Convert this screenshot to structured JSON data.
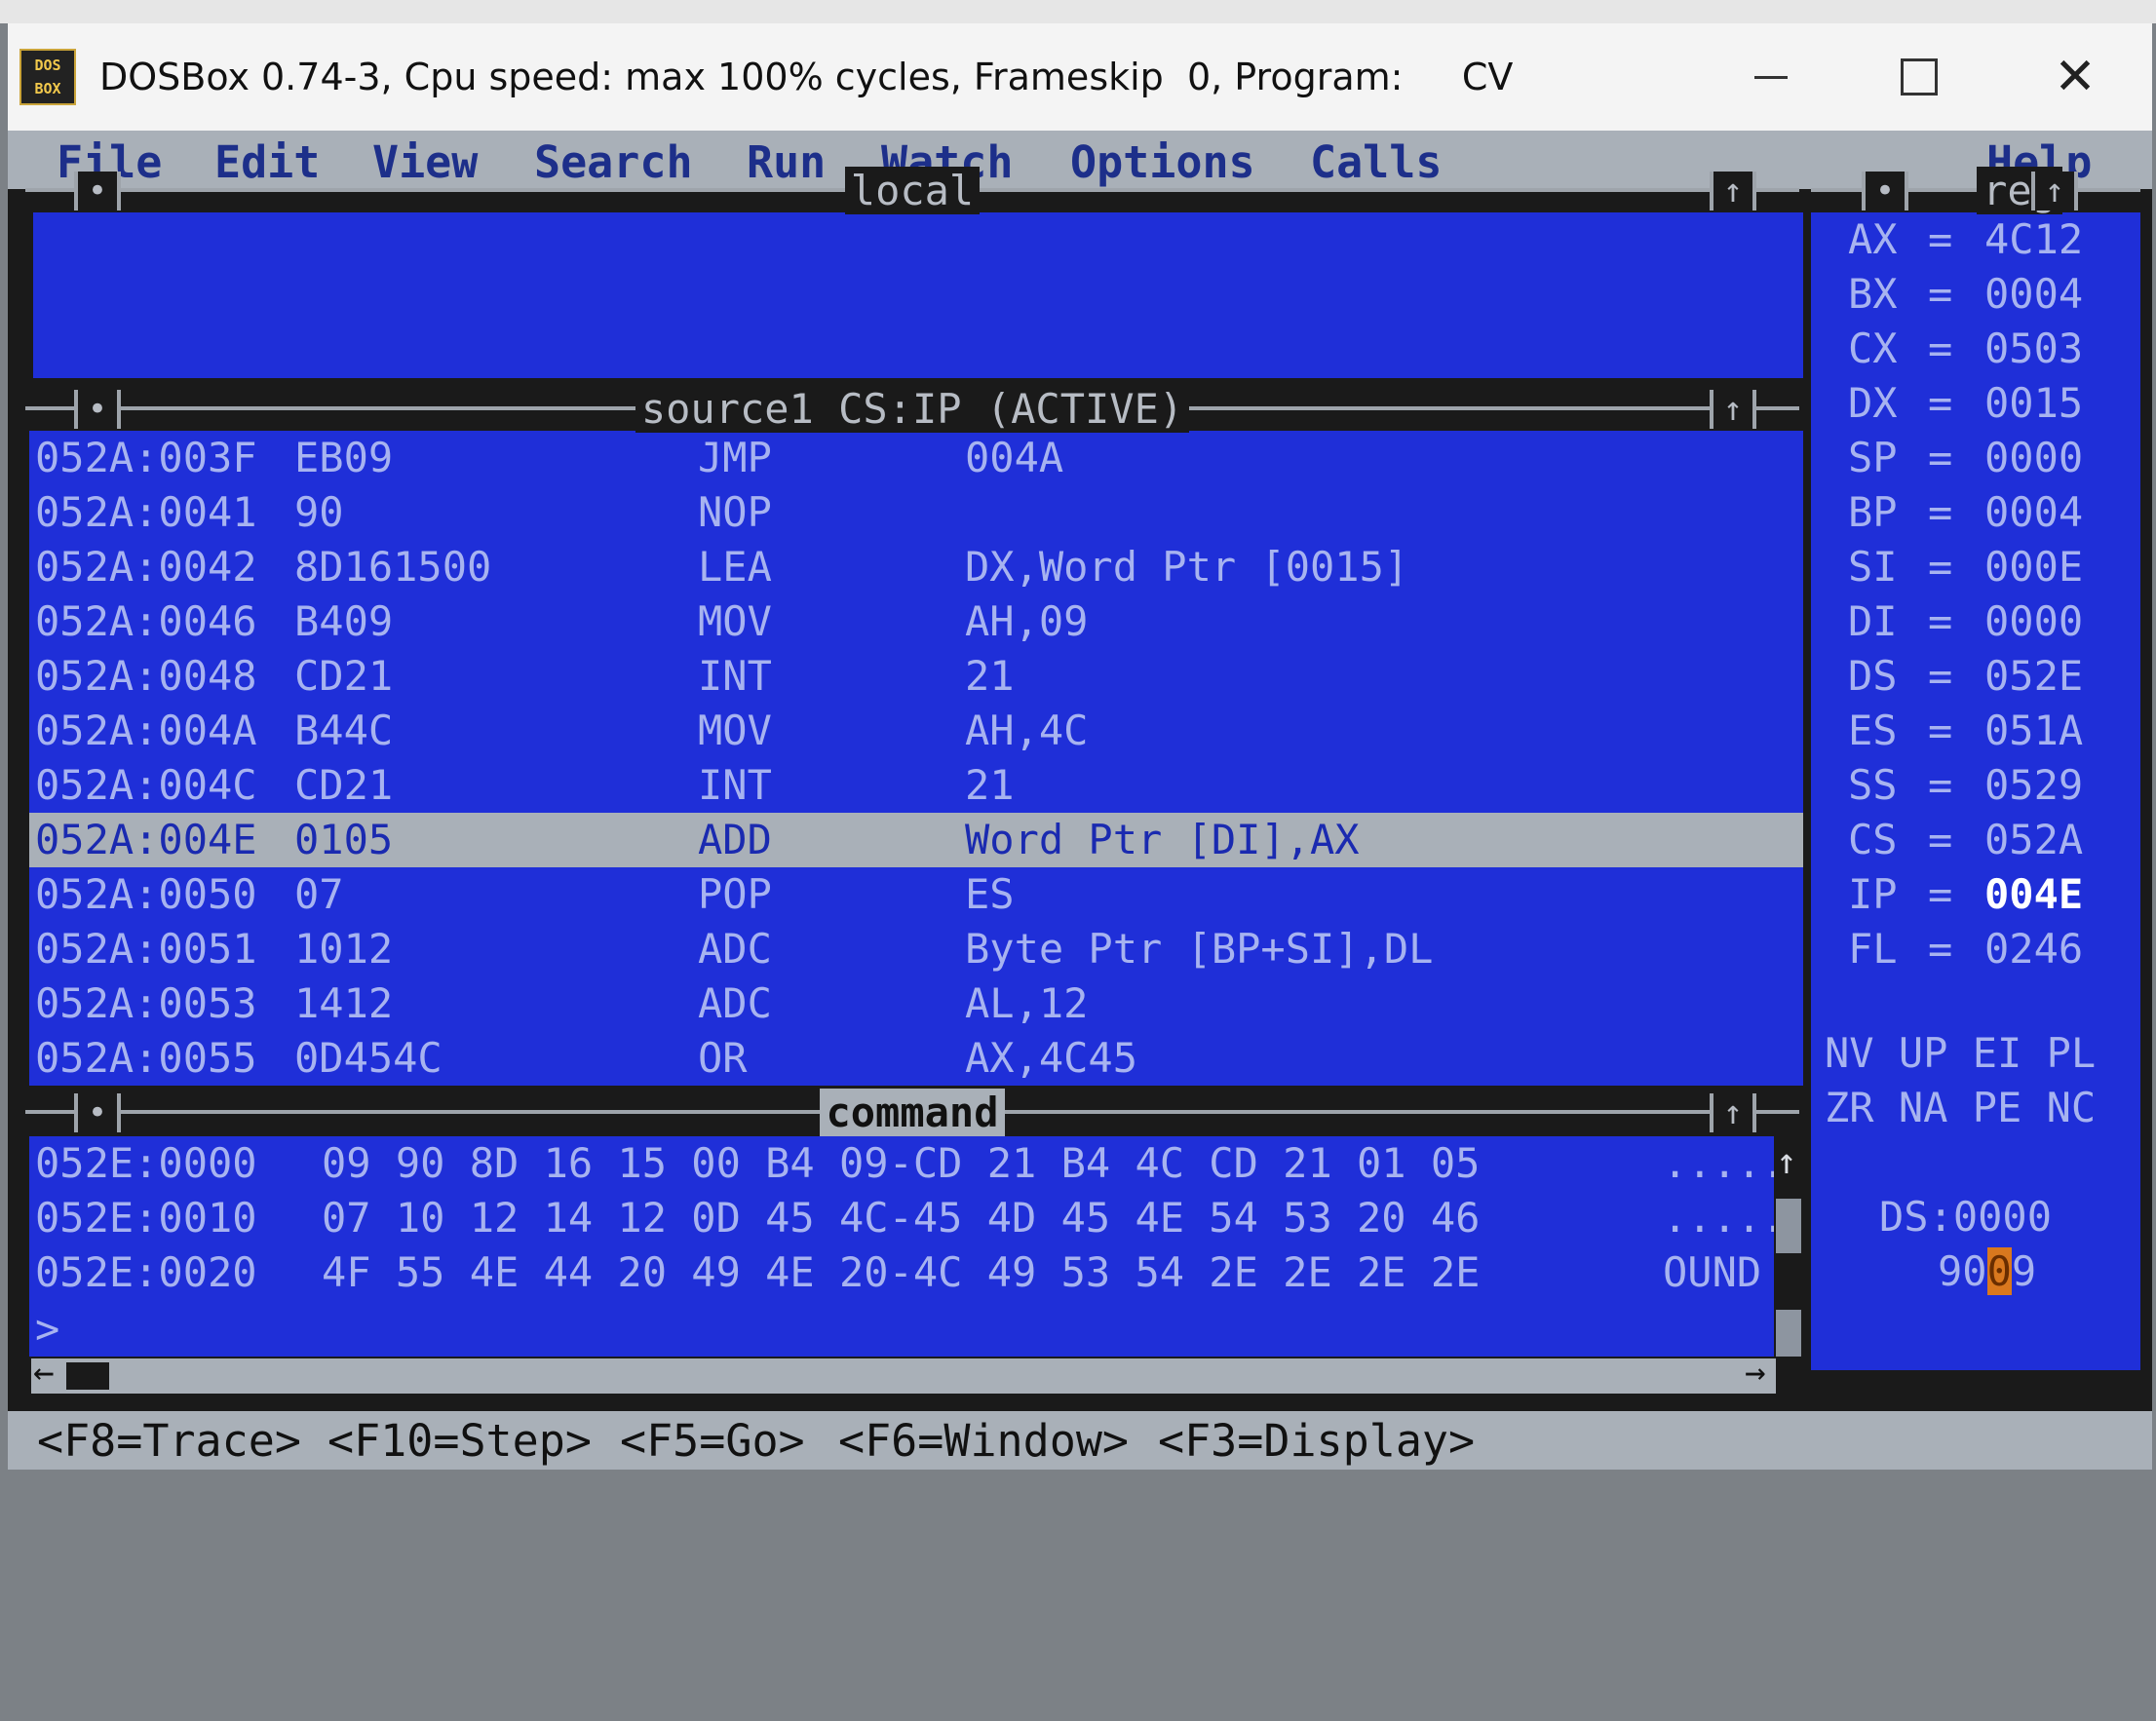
{
  "window": {
    "icon_text": [
      "DOS",
      "BOX"
    ],
    "title": "DOSBox 0.74-3, Cpu speed: max 100% cycles, Frameskip  0, Program:     CV",
    "controls": {
      "minimize": "—",
      "maximize": "☐",
      "close": "✕"
    }
  },
  "menu": {
    "items": [
      "File",
      "Edit",
      "View",
      "Search",
      "Run",
      "Watch",
      "Options",
      "Calls"
    ],
    "help": "Help"
  },
  "panes": {
    "local_title": "local",
    "source_title": "source1 CS:IP (ACTIVE)",
    "command_title": "command",
    "reg_title": "reg",
    "frame_button": "•",
    "max_button": "↑"
  },
  "source_lines": [
    {
      "addr": "052A:003F",
      "code": "EB09",
      "mnemonic": "JMP",
      "operands": "004A"
    },
    {
      "addr": "052A:0041",
      "code": "90",
      "mnemonic": "NOP",
      "operands": ""
    },
    {
      "addr": "052A:0042",
      "code": "8D161500",
      "mnemonic": "LEA",
      "operands": "DX,Word Ptr [0015]"
    },
    {
      "addr": "052A:0046",
      "code": "B409",
      "mnemonic": "MOV",
      "operands": "AH,09"
    },
    {
      "addr": "052A:0048",
      "code": "CD21",
      "mnemonic": "INT",
      "operands": "21"
    },
    {
      "addr": "052A:004A",
      "code": "B44C",
      "mnemonic": "MOV",
      "operands": "AH,4C"
    },
    {
      "addr": "052A:004C",
      "code": "CD21",
      "mnemonic": "INT",
      "operands": "21"
    },
    {
      "addr": "052A:004E",
      "code": "0105",
      "mnemonic": "ADD",
      "operands": "Word Ptr [DI],AX"
    },
    {
      "addr": "052A:0050",
      "code": "07",
      "mnemonic": "POP",
      "operands": "ES"
    },
    {
      "addr": "052A:0051",
      "code": "1012",
      "mnemonic": "ADC",
      "operands": "Byte Ptr [BP+SI],DL"
    },
    {
      "addr": "052A:0053",
      "code": "1412",
      "mnemonic": "ADC",
      "operands": "AL,12"
    },
    {
      "addr": "052A:0055",
      "code": "0D454C",
      "mnemonic": "OR",
      "operands": "AX,4C45"
    }
  ],
  "registers": [
    {
      "name": "AX",
      "eq": "=",
      "value": "4C12"
    },
    {
      "name": "BX",
      "eq": "=",
      "value": "0004"
    },
    {
      "name": "CX",
      "eq": "=",
      "value": "0503"
    },
    {
      "name": "DX",
      "eq": "=",
      "value": "0015"
    },
    {
      "name": "SP",
      "eq": "=",
      "value": "0000"
    },
    {
      "name": "BP",
      "eq": "=",
      "value": "0004"
    },
    {
      "name": "SI",
      "eq": "=",
      "value": "000E"
    },
    {
      "name": "DI",
      "eq": "=",
      "value": "0000"
    },
    {
      "name": "DS",
      "eq": "=",
      "value": "052E"
    },
    {
      "name": "ES",
      "eq": "=",
      "value": "051A"
    },
    {
      "name": "SS",
      "eq": "=",
      "value": "0529"
    },
    {
      "name": "CS",
      "eq": "=",
      "value": "052A"
    },
    {
      "name": "IP",
      "eq": "=",
      "value": "004E"
    },
    {
      "name": "FL",
      "eq": "=",
      "value": "0246"
    }
  ],
  "flags": {
    "row1": "NV UP EI PL",
    "row2": "ZR NA PE NC"
  },
  "ds_watch": {
    "label": "DS:0000",
    "value_pre": "90",
    "value_cursor": "0",
    "value_post": "9"
  },
  "command_lines": [
    {
      "addr": "052E:0000",
      "bytes": "09 90 8D 16 15 00 B4 09-CD 21 B4 4C CD 21 01 05",
      "ascii": "....."
    },
    {
      "addr": "052E:0010",
      "bytes": "07 10 12 14 12 0D 45 4C-45 4D 45 4E 54 53 20 46",
      "ascii": "....."
    },
    {
      "addr": "052E:0020",
      "bytes": "4F 55 4E 44 20 49 4E 20-4C 49 53 54 2E 2E 2E 2E",
      "ascii": "OUND"
    }
  ],
  "prompt": ">",
  "status": [
    "<F8=Trace>",
    "<F10=Step>",
    "<F5=Go>",
    "<F6=Window>",
    "<F3=Display>"
  ]
}
